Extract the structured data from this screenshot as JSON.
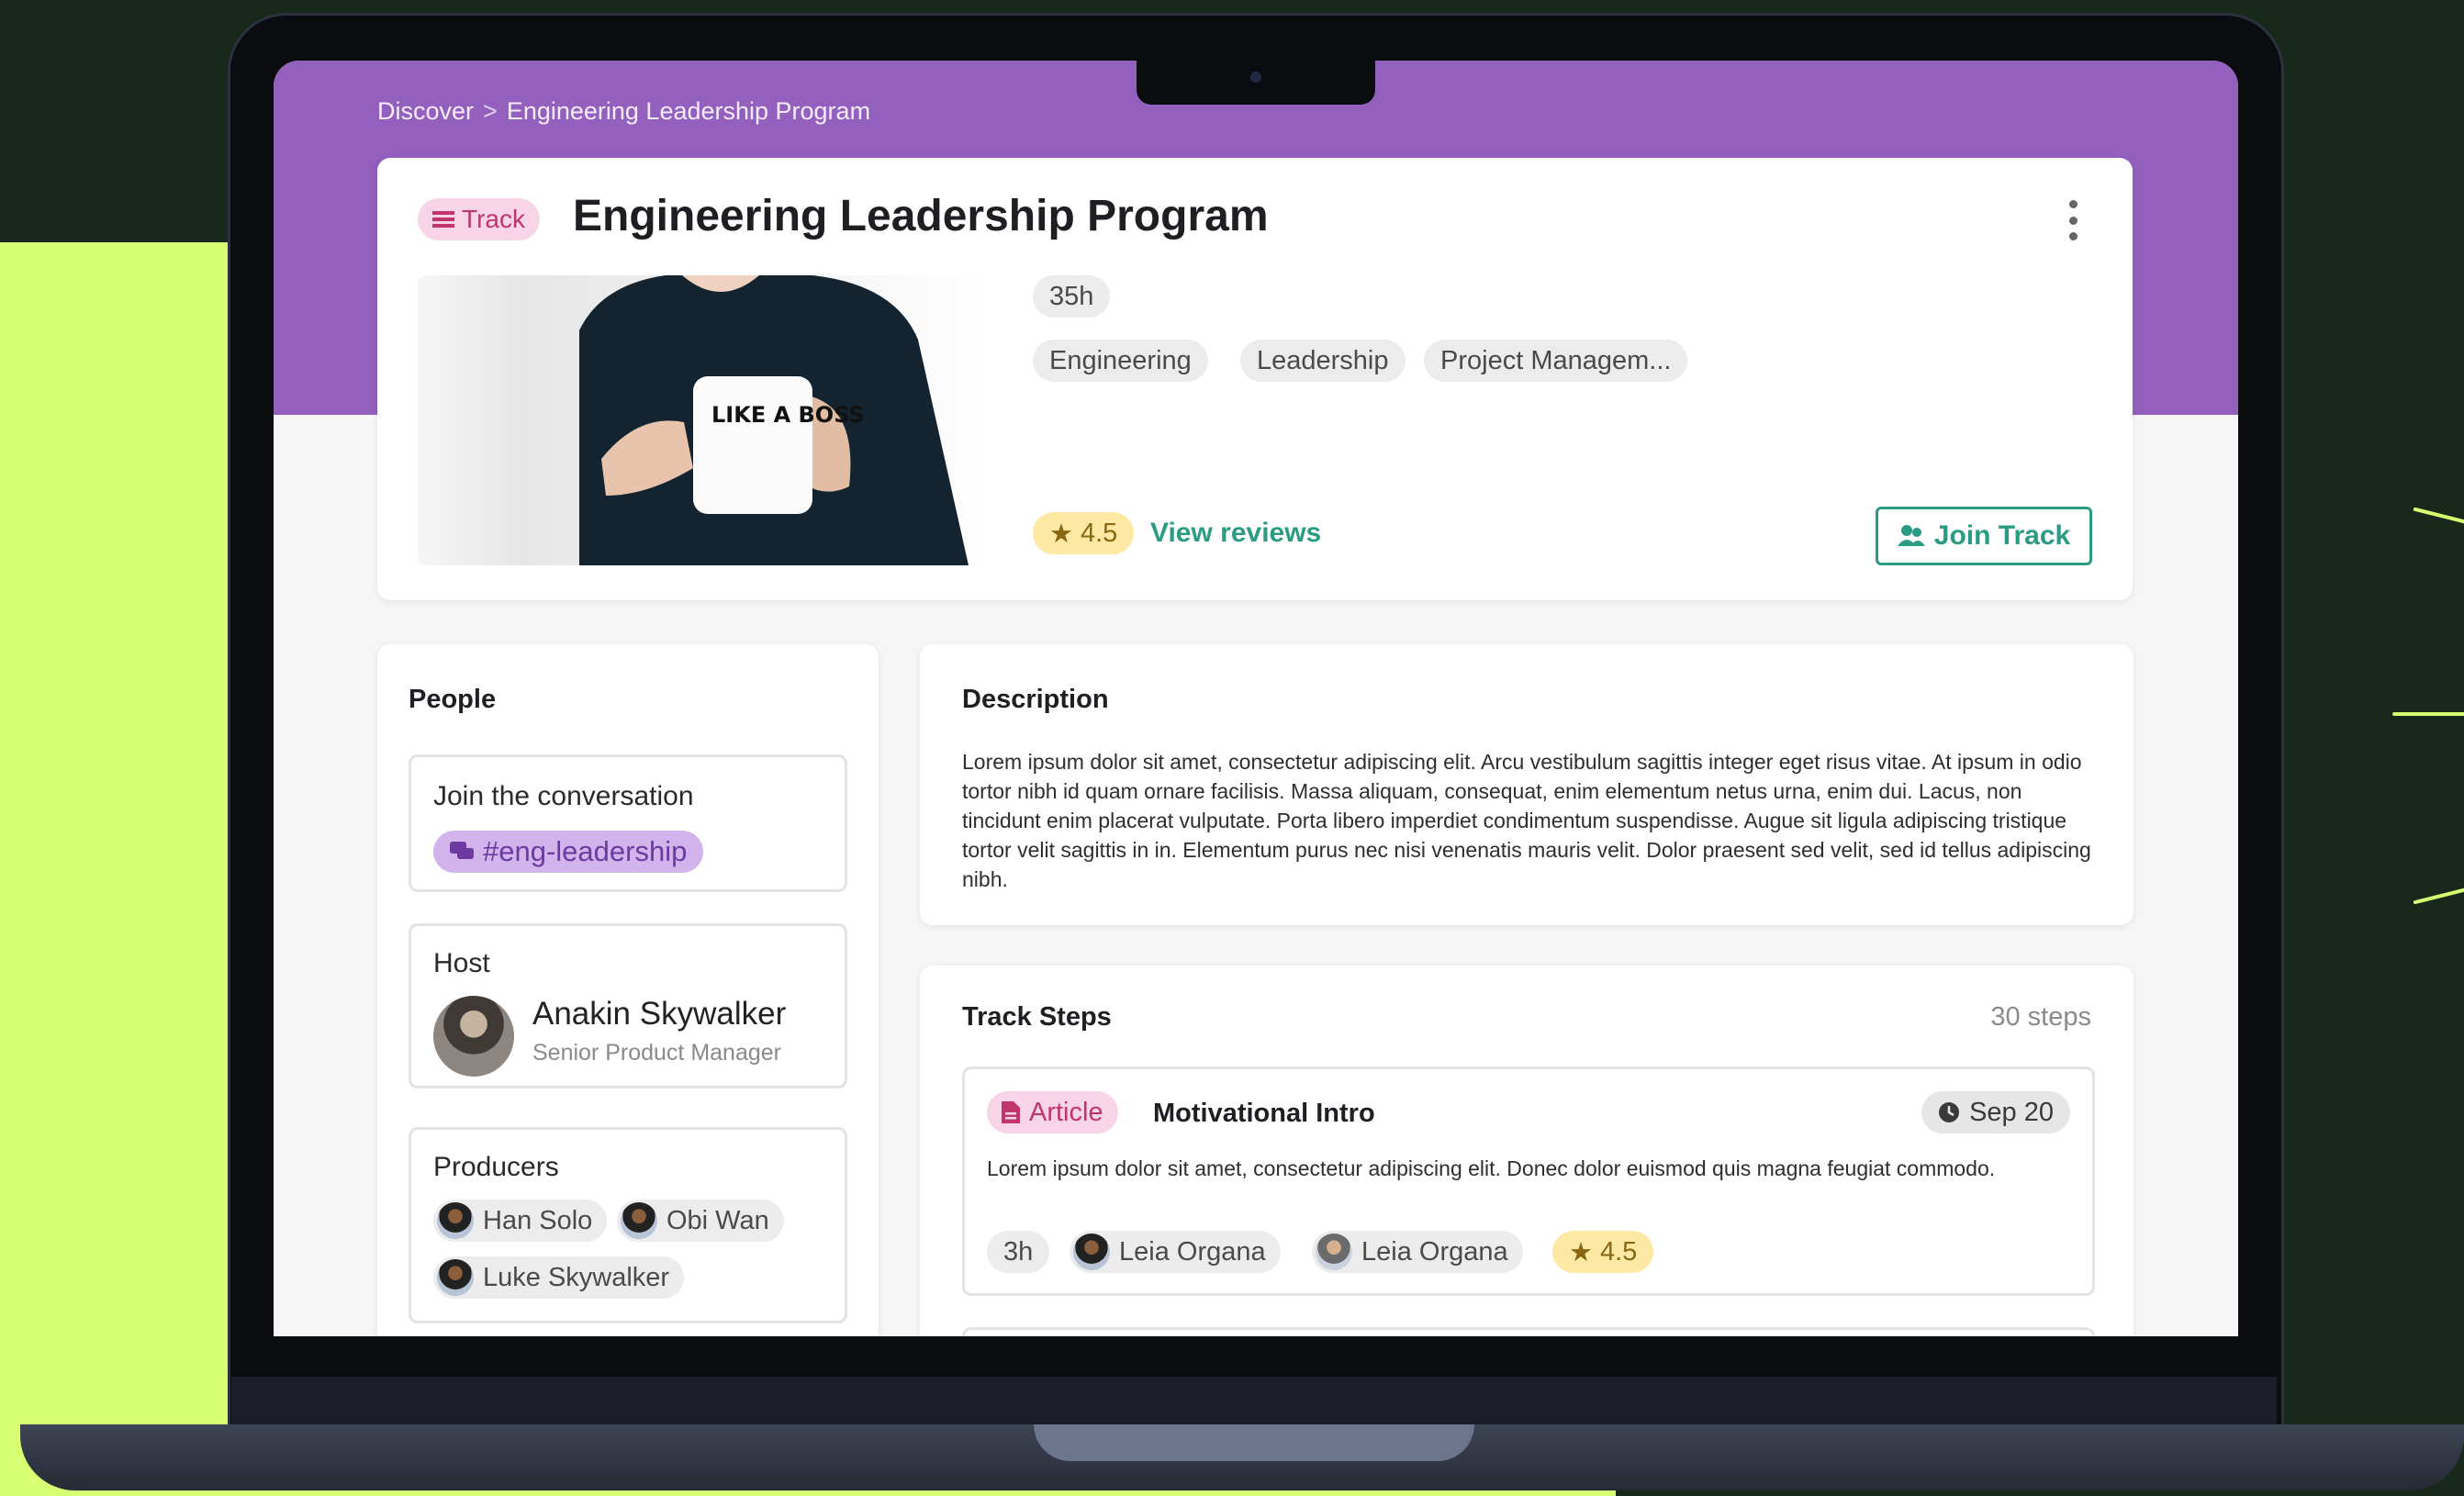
{
  "colors": {
    "accent_purple": "#9360bd",
    "teal": "#2b9b84",
    "background_lime": "#d6ff72",
    "background_dark": "#16291b"
  },
  "breadcrumb": {
    "root": "Discover",
    "separator": ">",
    "current": "Engineering Leadership Program"
  },
  "header": {
    "badge_label": "Track",
    "badge_icon": "list-icon",
    "title": "Engineering Leadership Program",
    "menu_icon": "kebab-menu-icon",
    "hero_image": "person-holding-like-a-boss-mug",
    "mug_text": "LIKE A BOSS",
    "duration": "35h",
    "tags": [
      "Engineering",
      "Leadership",
      "Project Managem..."
    ],
    "rating": "4.5",
    "view_reviews_label": "View reviews",
    "join_button_label": "Join Track",
    "join_icon": "users-plus-icon"
  },
  "people": {
    "title": "People",
    "conversation": {
      "label": "Join the conversation",
      "channel": "#eng-leadership",
      "channel_icon": "chat-icon"
    },
    "host": {
      "label": "Host",
      "name": "Anakin Skywalker",
      "role": "Senior Product Manager"
    },
    "producers": {
      "label": "Producers",
      "names": [
        "Han Solo",
        "Obi Wan",
        "Luke Skywalker"
      ]
    }
  },
  "description": {
    "title": "Description",
    "text": "Lorem ipsum dolor sit amet, consectetur adipiscing elit. Arcu vestibulum sagittis integer eget risus vitae. At ipsum in odio tortor nibh id quam ornare facilisis. Massa aliquam, consequat, enim elementum netus urna, enim dui. Lacus, non tincidunt enim placerat vulputate. Porta libero imperdiet condimentum suspendisse. Augue sit ligula adipiscing tristique tortor velit sagittis in in. Elementum purus nec nisi venenatis mauris velit. Dolor praesent sed velit, sed id tellus adipiscing nibh."
  },
  "track_steps": {
    "title": "Track Steps",
    "count": "30 steps",
    "items": [
      {
        "type_label": "Article",
        "type_icon": "document-icon",
        "title": "Motivational Intro",
        "date": "Sep 20",
        "date_icon": "clock-icon",
        "description": "Lorem ipsum dolor sit amet, consectetur adipiscing elit. Donec dolor euismod quis magna feugiat commodo.",
        "duration": "3h",
        "authors": [
          "Leia Organa",
          "Leia Organa"
        ],
        "rating": "4.5"
      }
    ]
  }
}
